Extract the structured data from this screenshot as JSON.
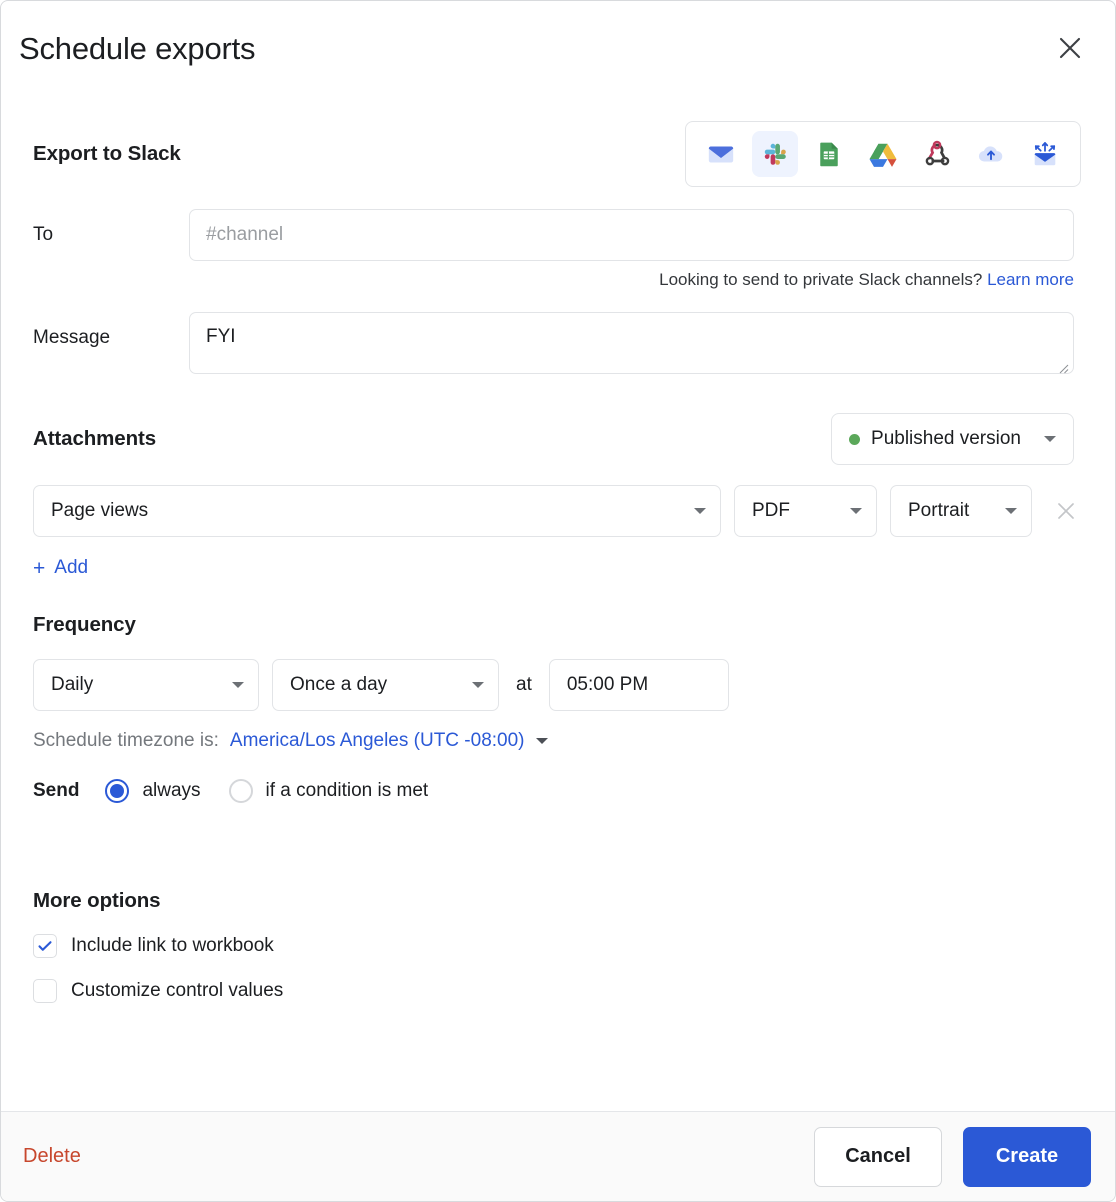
{
  "dialog": {
    "title": "Schedule exports",
    "close_icon": "close-icon"
  },
  "destination": {
    "heading": "Export to Slack",
    "services": [
      {
        "name": "email",
        "label": "Email",
        "selected": false
      },
      {
        "name": "slack",
        "label": "Slack",
        "selected": true
      },
      {
        "name": "google-sheets",
        "label": "Google Sheets",
        "selected": false
      },
      {
        "name": "google-drive",
        "label": "Google Drive",
        "selected": false
      },
      {
        "name": "webhook",
        "label": "Webhook",
        "selected": false
      },
      {
        "name": "cloud-upload",
        "label": "Cloud storage",
        "selected": false
      },
      {
        "name": "email-broadcast",
        "label": "Send to many",
        "selected": false
      }
    ]
  },
  "to": {
    "label": "To",
    "value": "",
    "placeholder": "#channel",
    "helper_text": "Looking to send to private Slack channels?",
    "helper_link": "Learn more"
  },
  "message": {
    "label": "Message",
    "value": "FYI"
  },
  "attachments": {
    "heading": "Attachments",
    "version": {
      "label": "Published version",
      "dot_color": "#5ba85a"
    },
    "rows": [
      {
        "page": "Page views",
        "format": "PDF",
        "orientation": "Portrait"
      }
    ],
    "add_label": "Add",
    "add_plus": "+"
  },
  "frequency": {
    "heading": "Frequency",
    "interval": "Daily",
    "repeat": "Once a day",
    "at_label": "at",
    "time": "05:00 PM",
    "timezone_prefix": "Schedule timezone is:",
    "timezone": "America/Los Angeles (UTC -08:00)"
  },
  "send": {
    "label": "Send",
    "options": [
      {
        "label": "always",
        "selected": true
      },
      {
        "label": "if a condition is met",
        "selected": false
      }
    ]
  },
  "more_options": {
    "heading": "More options",
    "items": [
      {
        "label": "Include link to workbook",
        "checked": true
      },
      {
        "label": "Customize control values",
        "checked": false
      }
    ]
  },
  "footer": {
    "delete_label": "Delete",
    "cancel_label": "Cancel",
    "create_label": "Create"
  },
  "colors": {
    "accent": "#2b59d6",
    "danger": "#c7472d",
    "success": "#5ba85a",
    "border": "#e2e4e7"
  }
}
